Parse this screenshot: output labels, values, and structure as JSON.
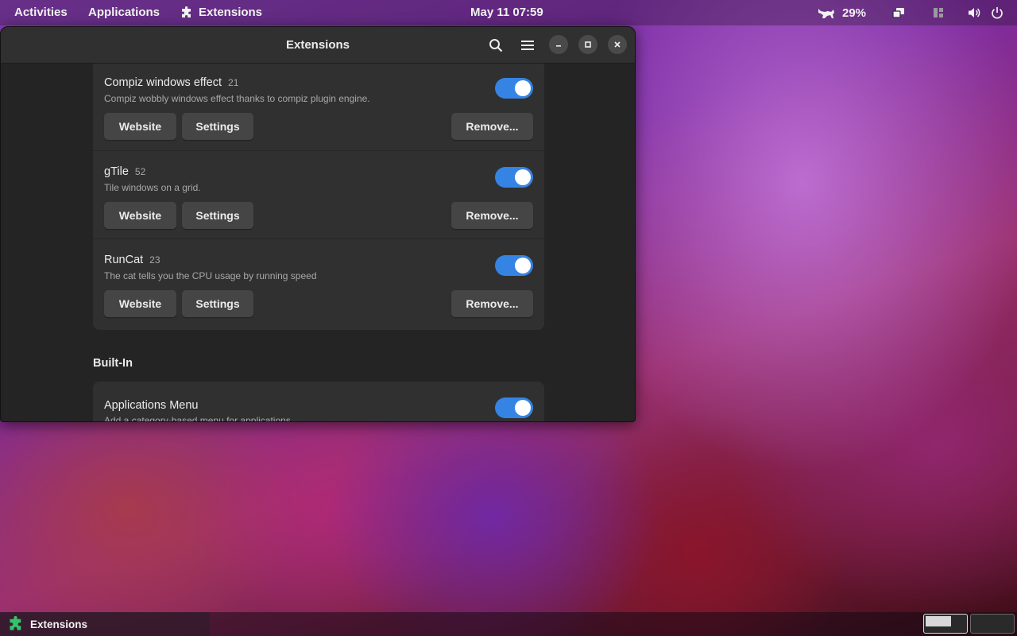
{
  "topbar": {
    "activities": "Activities",
    "applications": "Applications",
    "focused_app": "Extensions",
    "clock": "May 11  07:59",
    "cpu_percent": "29%"
  },
  "window": {
    "title": "Extensions",
    "icons": {
      "search": "search-icon",
      "menu": "hamburger-menu-icon",
      "minimize": "minimize-icon",
      "maximize": "maximize-icon",
      "close": "close-icon"
    }
  },
  "user_extensions": [
    {
      "name": "Compiz windows effect",
      "version": "21",
      "description": "Compiz wobbly windows effect thanks to compiz plugin engine.",
      "enabled": true
    },
    {
      "name": "gTile",
      "version": "52",
      "description": "Tile windows on a grid.",
      "enabled": true
    },
    {
      "name": "RunCat",
      "version": "23",
      "description": "The cat tells you the CPU usage by running speed",
      "enabled": true
    }
  ],
  "buttons": {
    "website": "Website",
    "settings": "Settings",
    "remove": "Remove..."
  },
  "builtin": {
    "section_title": "Built-In",
    "extensions": [
      {
        "name": "Applications Menu",
        "description": "Add a category-based menu for applications.",
        "enabled": true
      }
    ]
  },
  "taskbar": {
    "task_label": "Extensions"
  },
  "colors": {
    "accent": "#3584e4",
    "window_bg": "#242424",
    "card_bg": "#303030",
    "button_bg": "#454545",
    "extension_icon_green": "#33c36a"
  }
}
